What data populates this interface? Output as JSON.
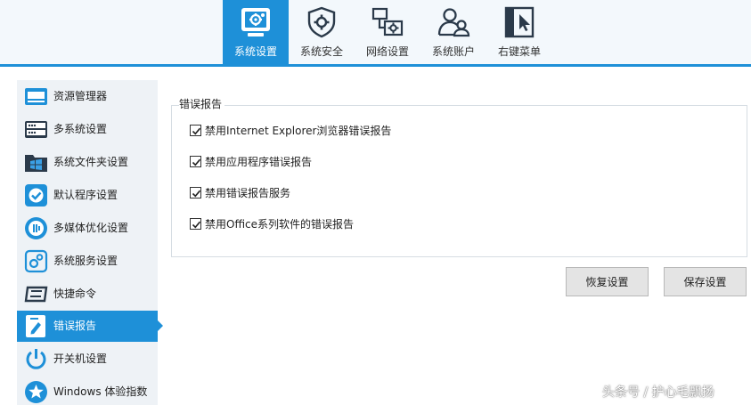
{
  "toolbar": {
    "items": [
      {
        "label": "系统设置",
        "icon": "system-settings-icon",
        "active": true
      },
      {
        "label": "系统安全",
        "icon": "shield-gear-icon",
        "active": false
      },
      {
        "label": "网络设置",
        "icon": "network-icon",
        "active": false
      },
      {
        "label": "系统账户",
        "icon": "users-icon",
        "active": false
      },
      {
        "label": "右键菜单",
        "icon": "cursor-menu-icon",
        "active": false
      }
    ],
    "accent_color": "#1e90d8"
  },
  "sidebar": {
    "items": [
      {
        "label": "资源管理器",
        "icon": "explorer-icon"
      },
      {
        "label": "多系统设置",
        "icon": "multi-system-icon"
      },
      {
        "label": "系统文件夹设置",
        "icon": "windows-folder-icon"
      },
      {
        "label": "默认程序设置",
        "icon": "default-program-check-icon"
      },
      {
        "label": "多媒体优化设置",
        "icon": "multimedia-icon"
      },
      {
        "label": "系统服务设置",
        "icon": "service-gear-icon"
      },
      {
        "label": "快捷命令",
        "icon": "shortcut-command-icon"
      },
      {
        "label": "错误报告",
        "icon": "error-report-icon",
        "active": true
      },
      {
        "label": "开关机设置",
        "icon": "power-icon"
      },
      {
        "label": "Windows 体验指数",
        "icon": "star-icon"
      }
    ]
  },
  "error_report": {
    "group_title": "错误报告",
    "options": [
      {
        "label": "禁用Internet Explorer浏览器错误报告",
        "checked": true
      },
      {
        "label": "禁用应用程序错误报告",
        "checked": true
      },
      {
        "label": "禁用错误报告服务",
        "checked": true
      },
      {
        "label": "禁用Office系列软件的错误报告",
        "checked": true
      }
    ]
  },
  "buttons": {
    "restore": "恢复设置",
    "save": "保存设置"
  },
  "watermark": "头条号 / 护心毛飘扬"
}
